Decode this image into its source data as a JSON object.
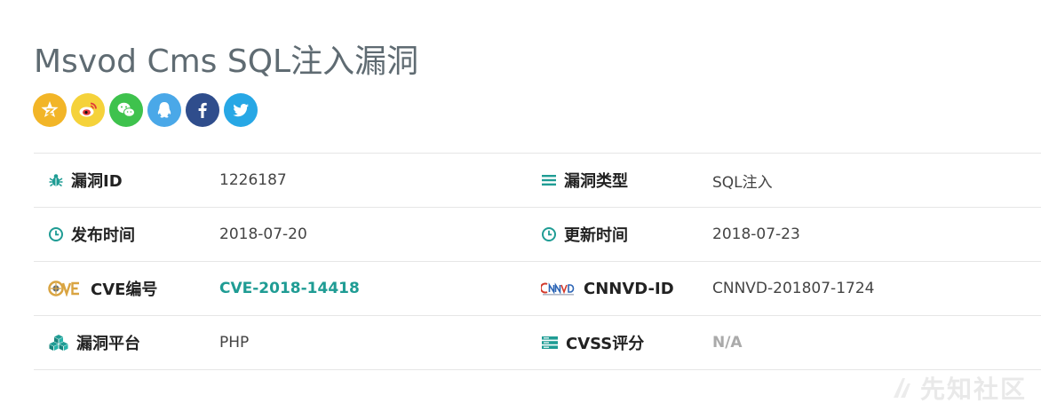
{
  "page": {
    "title": "Msvod Cms SQL注入漏洞",
    "watermark": "先知社区"
  },
  "share": [
    {
      "icon": "qzone-icon",
      "color": "#f2b527"
    },
    {
      "icon": "weibo-icon",
      "color": "#f5d23a"
    },
    {
      "icon": "wechat-icon",
      "color": "#3ec24d"
    },
    {
      "icon": "qq-icon",
      "color": "#4aa8e8"
    },
    {
      "icon": "facebook-icon",
      "color": "#2f4d8c"
    },
    {
      "icon": "twitter-icon",
      "color": "#27a7e5"
    }
  ],
  "details": {
    "vuln_id_label": "漏洞ID",
    "vuln_id_value": "1226187",
    "vuln_type_label": "漏洞类型",
    "vuln_type_value": "SQL注入",
    "publish_label": "发布时间",
    "publish_value": "2018-07-20",
    "update_label": "更新时间",
    "update_value": "2018-07-23",
    "cve_label": "CVE编号",
    "cve_value": "CVE-2018-14418",
    "cnnvd_label": "CNNVD-ID",
    "cnnvd_value": "CNNVD-201807-1724",
    "platform_label": "漏洞平台",
    "platform_value": "PHP",
    "cvss_label": "CVSS评分",
    "cvss_value": "N/A"
  },
  "colors": {
    "accent": "#1f9c94",
    "cve_logo": "#d9a441",
    "cnnvd_logo": "#d33a2c"
  }
}
